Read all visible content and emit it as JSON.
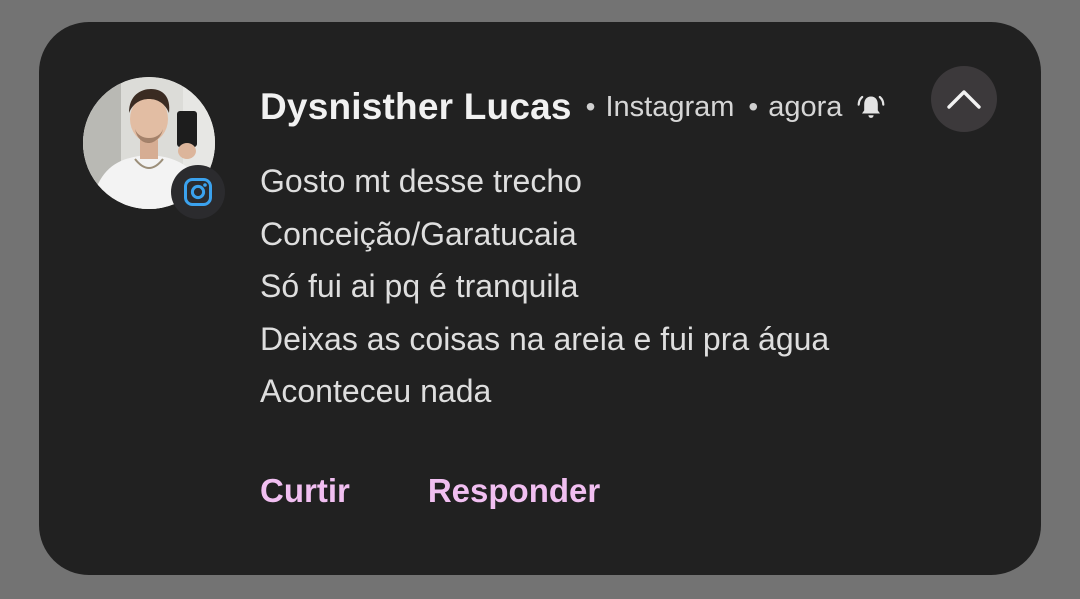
{
  "notification": {
    "sender": "Dysnisther Lucas",
    "app_name": "Instagram",
    "time": "agora",
    "separator": "•",
    "message_lines": [
      "Gosto mt desse trecho",
      "Conceição/Garatucaia",
      "Só fui ai pq é tranquila",
      "Deixas as coisas na areia e fui pra água",
      "Aconteceu nada"
    ],
    "actions": {
      "like_label": "Curtir",
      "reply_label": "Responder"
    }
  },
  "icons": {
    "app_badge": "instagram-icon",
    "alert": "bell-ringing-icon",
    "collapse": "chevron-up-icon"
  },
  "colors": {
    "background": "#737373",
    "card": "#212121",
    "action_text": "#f1bff1",
    "instagram_icon": "#3ba2ee"
  }
}
